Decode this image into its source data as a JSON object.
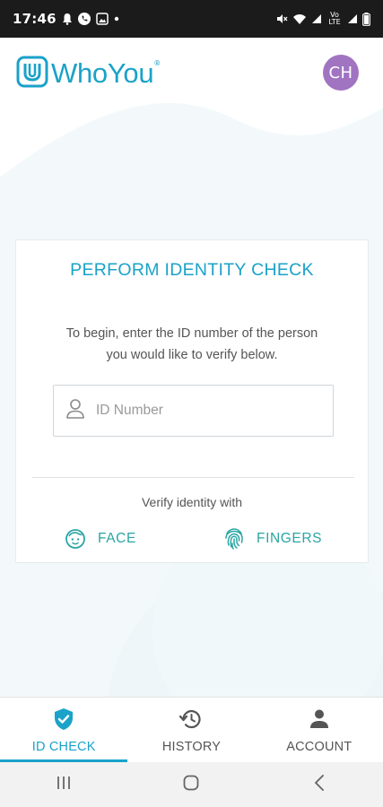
{
  "status_bar": {
    "time": "17:46",
    "left_icons": [
      "notification-icon",
      "phone-icon",
      "image-icon",
      "dot-icon"
    ],
    "right_text": "Vo LTE",
    "right_icons": [
      "mute-icon",
      "wifi-icon",
      "signal-icon",
      "signal-icon",
      "battery-icon"
    ]
  },
  "header": {
    "logo_text": "WhoYou",
    "logo_tm": "®",
    "avatar_initials": "CH",
    "avatar_color": "#a174c2"
  },
  "card": {
    "title": "PERFORM IDENTITY CHECK",
    "instructions_line1": "To begin, enter the ID number of the person",
    "instructions_line2": "you would like to verify below.",
    "id_input": {
      "placeholder": "ID Number",
      "value": ""
    },
    "verify_label": "Verify identity with",
    "face_label": "FACE",
    "fingers_label": "FINGERS"
  },
  "bottom_nav": {
    "items": [
      {
        "label": "ID CHECK",
        "icon": "shield-check-icon",
        "active": true
      },
      {
        "label": "HISTORY",
        "icon": "history-icon",
        "active": false
      },
      {
        "label": "ACCOUNT",
        "icon": "person-icon",
        "active": false
      }
    ]
  },
  "colors": {
    "accent": "#1aa2c9",
    "teal": "#2aa5a4",
    "avatar": "#a174c2"
  }
}
